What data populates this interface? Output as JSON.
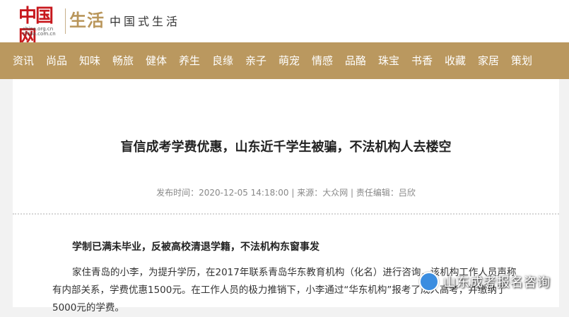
{
  "header": {
    "logo_main": "中国网",
    "logo_url1": "china.org.cn",
    "logo_url2": "china.com.cn",
    "logo_life": "生活",
    "tagline": "中国式生活"
  },
  "nav": {
    "items": [
      "资讯",
      "尚品",
      "知味",
      "畅旅",
      "健体",
      "养生",
      "良缘",
      "亲子",
      "萌宠",
      "情感",
      "品酪",
      "珠宝",
      "书香",
      "收藏",
      "家居",
      "策划"
    ]
  },
  "article": {
    "title": "盲信成考学费优惠，山东近千学生被骗，不法机构人去楼空",
    "meta": "发布时间：2020-12-05 14:18:00 | 来源：大众网 | 责任编辑：吕欣",
    "subhead": "学制已满未毕业，反被高校清退学籍，不法机构东窗事发",
    "paragraph": "家住青岛的小李，为提升学历，在2017年联系青岛华东教育机构（化名）进行咨询，该机构工作人员声称有内部关系，学费优惠1500元。在工作人员的极力推销下，小李通过“华东机构”报考了成人高考，并缴纳了5000元的学费。"
  },
  "watermark": {
    "text": "山东成考报名咨询",
    "icon": "wechat-account-icon"
  },
  "colors": {
    "nav_bg": "#ba985f",
    "logo_red": "#c7181d",
    "logo_gold": "#b9965b"
  }
}
